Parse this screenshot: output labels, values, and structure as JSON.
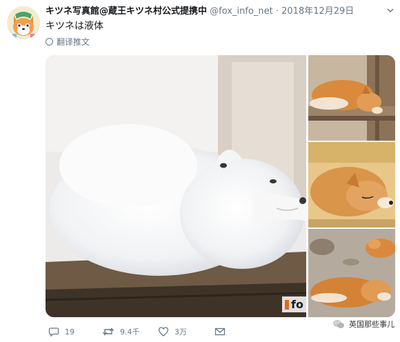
{
  "tweet": {
    "display_name": "キツネ写真館@蔵王キツネ村公式提携中",
    "handle": "@fox_info_net",
    "separator": "·",
    "date": "2018年12月29日",
    "text": "キツネは液体",
    "translate_label": "翻译推文"
  },
  "media": {
    "watermark": "fo"
  },
  "actions": {
    "reply_count": "19",
    "retweet_count": "9.4千",
    "like_count": "3万"
  },
  "overlay": {
    "wechat_label": "英国那些事儿"
  },
  "colors": {
    "text_primary": "#14171a",
    "text_secondary": "#657786"
  }
}
